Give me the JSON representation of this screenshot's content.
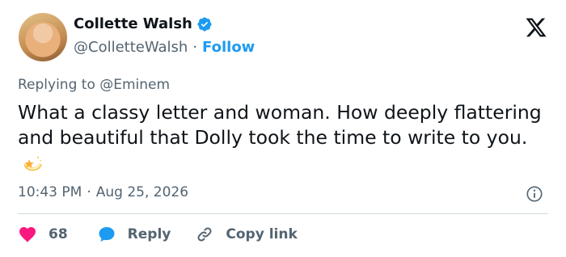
{
  "author": {
    "name": "Collette Walsh",
    "handle": "@ColletteWalsh",
    "separator": "·",
    "follow_label": "Follow"
  },
  "reply_context": {
    "prefix": "Replying to",
    "mention": "@Eminem"
  },
  "tweet": {
    "text": "What a classy letter and woman. How deeply flattering and beautiful that Dolly took the time to write to you.",
    "emoji": "dizzy-star-emoji"
  },
  "meta": {
    "time": "10:43 PM",
    "separator": "·",
    "date": "Aug 25, 2026"
  },
  "actions": {
    "likes_count": "68",
    "reply_label": "Reply",
    "copy_link_label": "Copy link"
  },
  "colors": {
    "accent": "#1d9bf0",
    "like": "#f91880",
    "muted": "#536471",
    "text": "#0f1419"
  },
  "icons": [
    "verified-badge-icon",
    "x-logo-icon",
    "info-icon",
    "heart-icon",
    "reply-bubble-icon",
    "link-icon"
  ]
}
